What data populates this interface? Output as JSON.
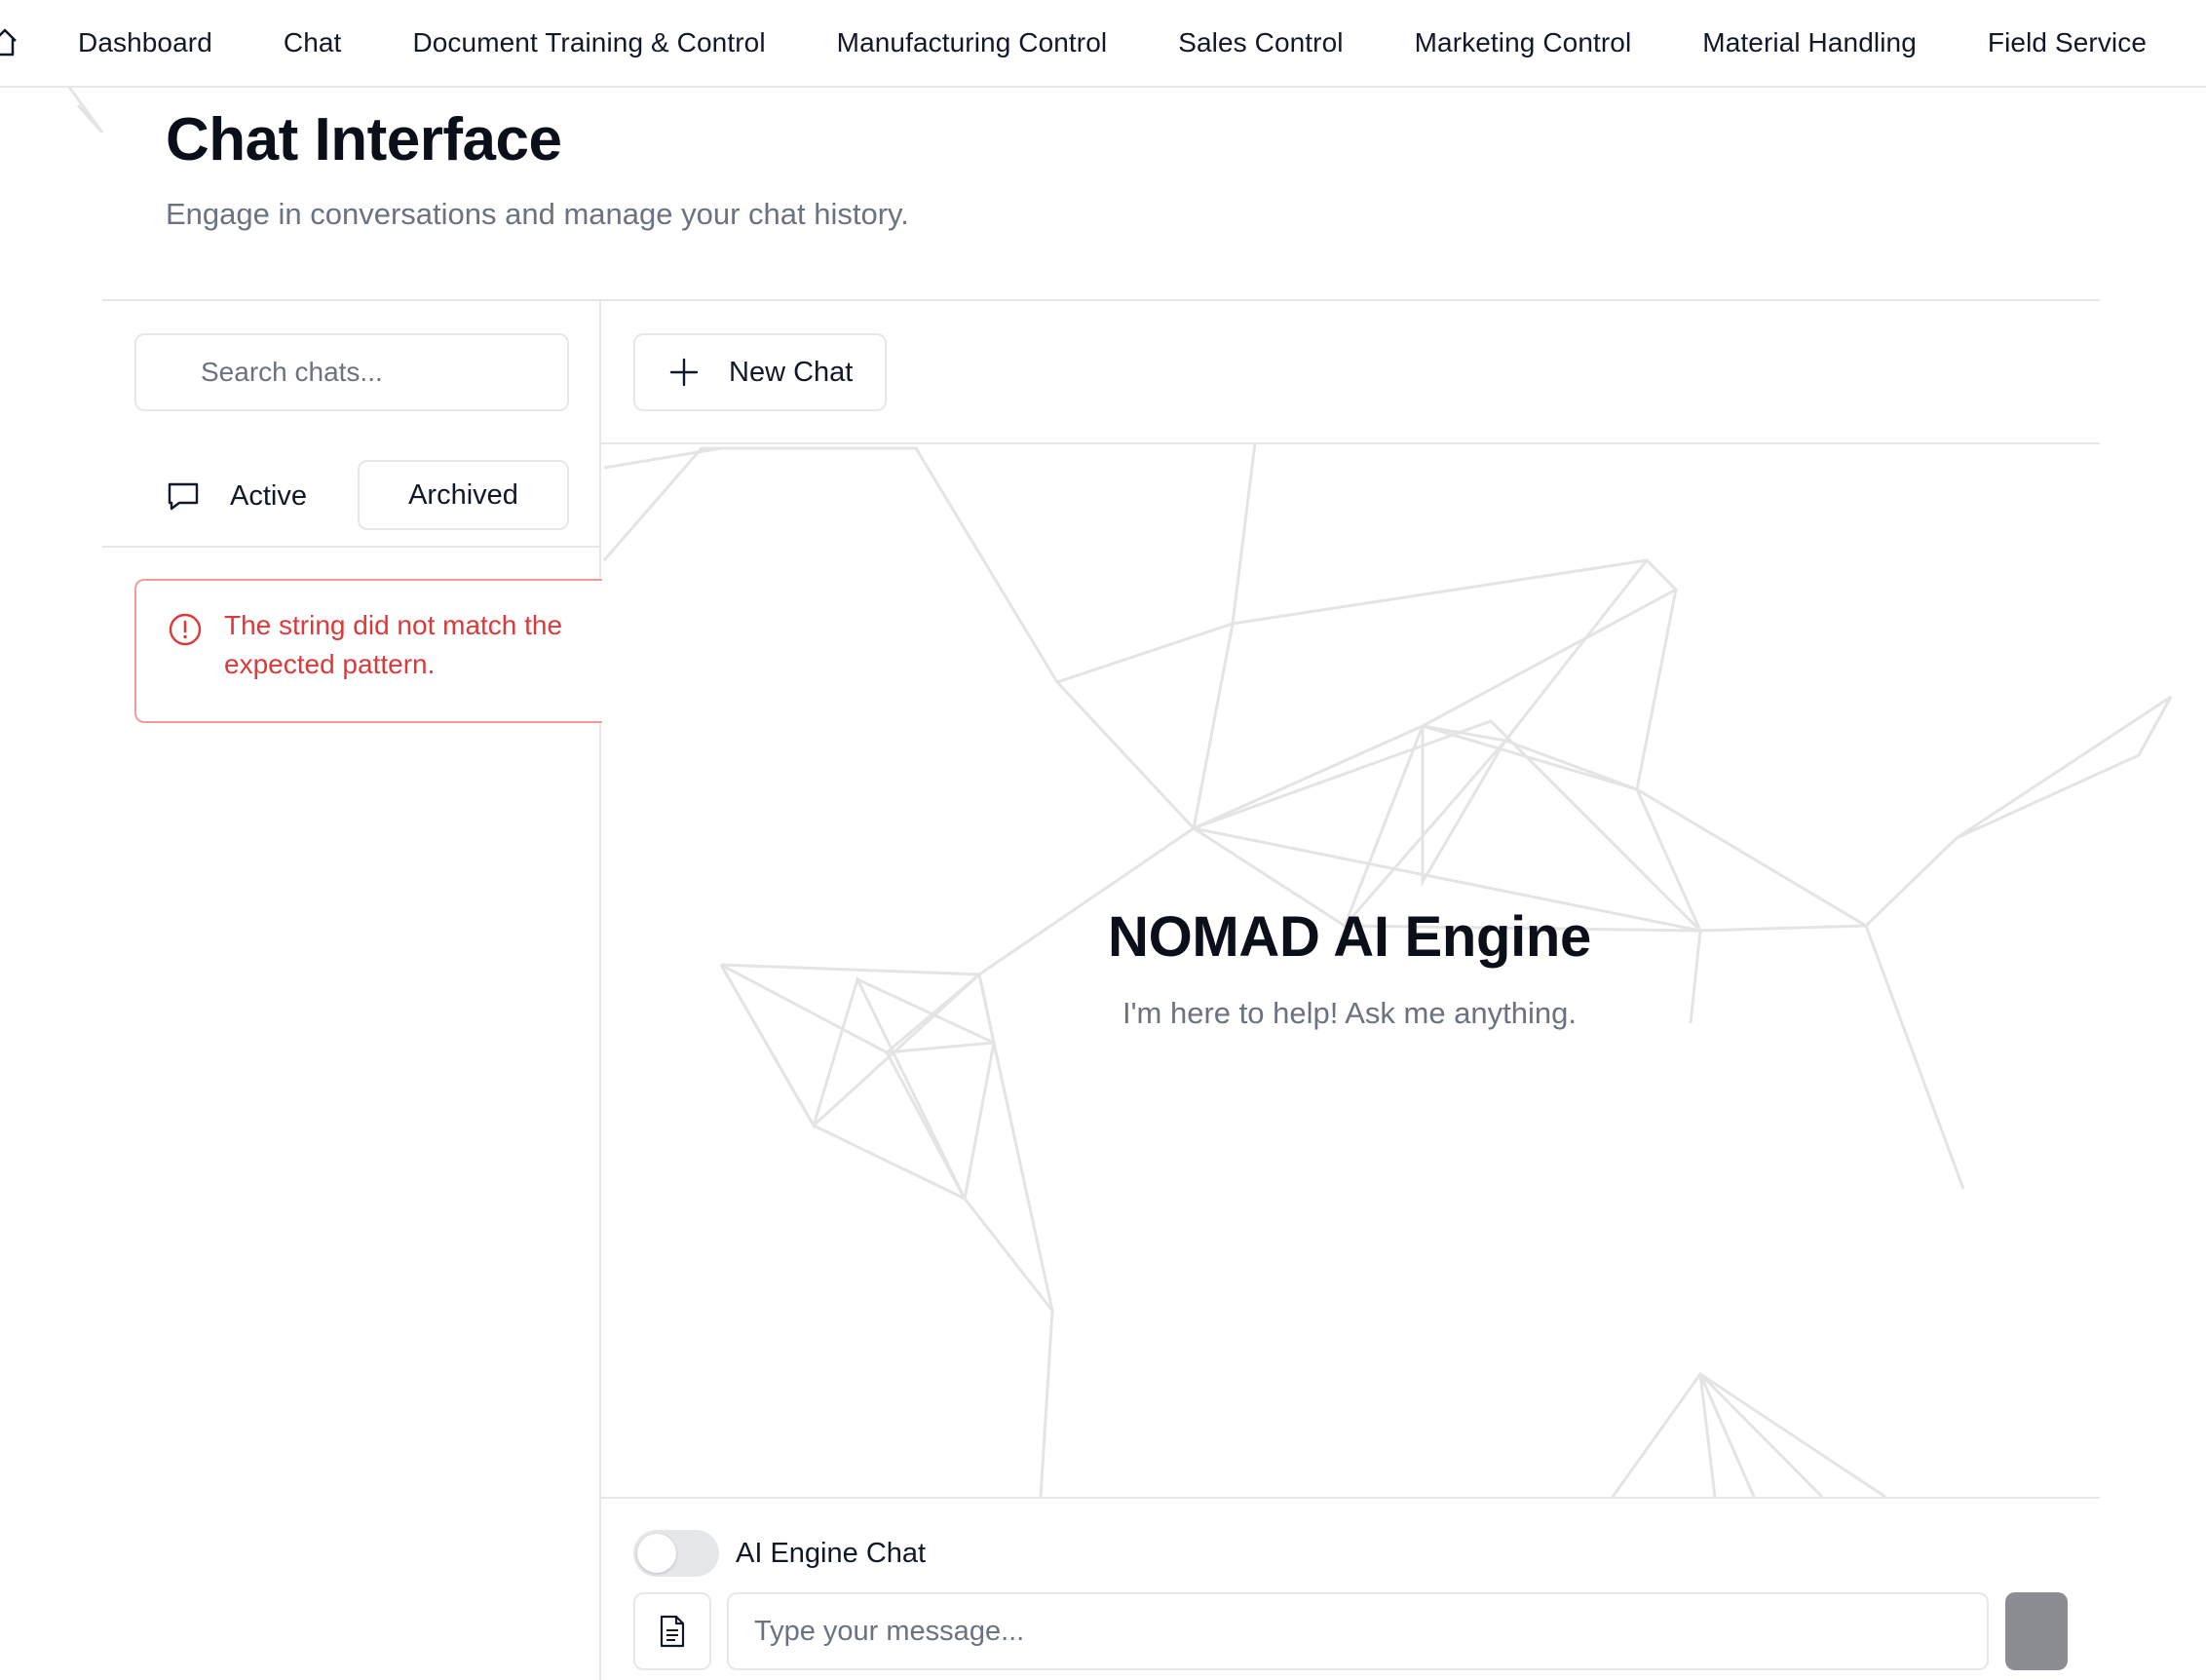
{
  "nav": {
    "items": [
      "Dashboard",
      "Chat",
      "Document Training & Control",
      "Manufacturing Control",
      "Sales Control",
      "Marketing Control",
      "Material Handling",
      "Field Service"
    ],
    "home_icon": "home-icon"
  },
  "header": {
    "title": "Chat Interface",
    "subtitle": "Engage in conversations and manage your chat history."
  },
  "sidebar": {
    "search_placeholder": "Search chats...",
    "tabs": {
      "active_label": "Active",
      "archived_label": "Archived"
    },
    "error_message": "The string did not match the expected pattern."
  },
  "toolbar": {
    "new_chat_label": "New Chat"
  },
  "empty_state": {
    "title": "NOMAD AI Engine",
    "subtitle": "I'm here to help! Ask me anything."
  },
  "composer": {
    "toggle_label": "AI Engine Chat",
    "toggle_on": false,
    "message_placeholder": "Type your message..."
  },
  "colors": {
    "error": "#dc3a3a",
    "border": "#e5e7eb",
    "muted_text": "#6b7280",
    "send_button": "#8b8d93"
  }
}
